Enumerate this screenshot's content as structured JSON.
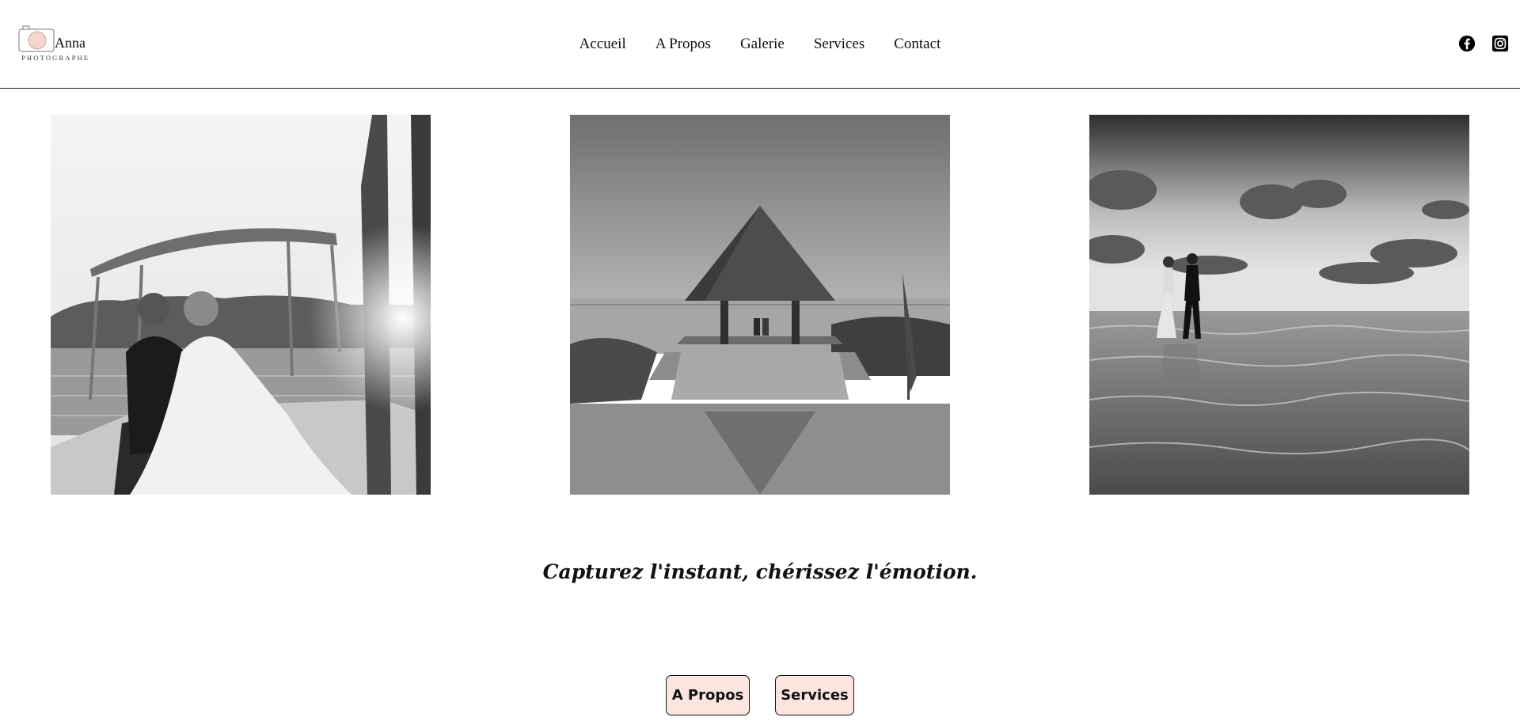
{
  "brand": {
    "name": "Anna",
    "subtitle": "PHOTOGRAPHE"
  },
  "nav": {
    "items": [
      {
        "label": "Accueil"
      },
      {
        "label": "A Propos"
      },
      {
        "label": "Galerie"
      },
      {
        "label": "Services"
      },
      {
        "label": "Contact"
      }
    ]
  },
  "social": [
    "facebook-icon",
    "instagram-icon"
  ],
  "gallery": [
    {
      "subject": "wedding-couple-on-boat"
    },
    {
      "subject": "couple-under-thatched-gazebo-by-pool"
    },
    {
      "subject": "couple-walking-in-sea-at-sunset"
    }
  ],
  "tagline": "Capturez l'instant, chérissez l'émotion.",
  "cta": {
    "about_label": "A Propos",
    "services_label": "Services"
  },
  "colors": {
    "accent": "#fbe6df",
    "text": "#111111",
    "background": "#ffffff"
  }
}
